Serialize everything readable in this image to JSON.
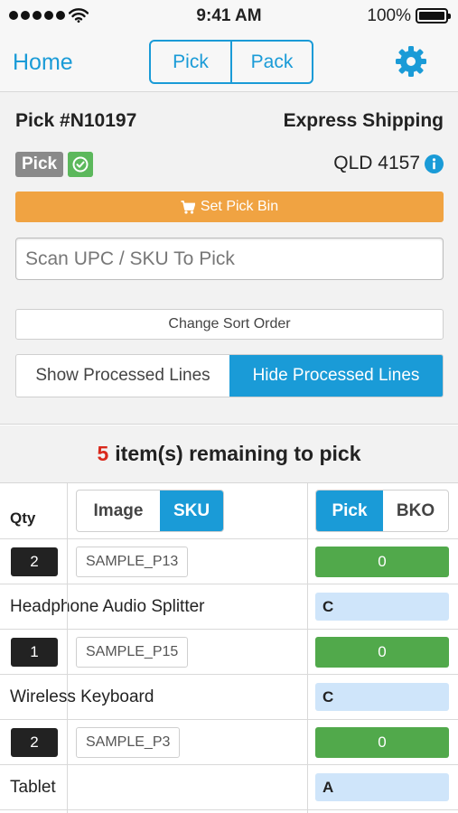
{
  "status_bar": {
    "time": "9:41 AM",
    "battery": "100%",
    "signal_icon": "signal-dots-icon",
    "wifi_icon": "wifi-icon",
    "battery_icon": "battery-icon"
  },
  "nav": {
    "home": "Home",
    "tabs": [
      "Pick",
      "Pack"
    ],
    "settings_icon": "gear-icon"
  },
  "order": {
    "title": "Pick #N10197",
    "shipping": "Express Shipping",
    "status": "Pick",
    "status_check_icon": "check-circle-icon",
    "postcode": "QLD 4157",
    "info_icon": "info-icon",
    "set_bin": "Set Pick Bin",
    "set_bin_icon": "cart-icon",
    "scan_placeholder": "Scan UPC / SKU To Pick",
    "sort_label": "Change Sort Order",
    "processed_toggle": {
      "show": "Show Processed Lines",
      "hide": "Hide Processed Lines",
      "active": "hide"
    }
  },
  "remaining": {
    "count": "5",
    "text": "item(s) remaining to pick"
  },
  "table": {
    "qty_header": "Qty",
    "view_toggle": {
      "image": "Image",
      "sku": "SKU",
      "active": "sku"
    },
    "mode_toggle": {
      "pick": "Pick",
      "bko": "BKO",
      "active": "pick"
    },
    "rows": [
      {
        "qty": "2",
        "sku": "SAMPLE_P13",
        "picked": "0",
        "name": "Headphone Audio Splitter",
        "bin": "C"
      },
      {
        "qty": "1",
        "sku": "SAMPLE_P15",
        "picked": "0",
        "name": "Wireless Keyboard",
        "bin": "C"
      },
      {
        "qty": "2",
        "sku": "SAMPLE_P3",
        "picked": "0",
        "name": "Tablet",
        "bin": "A"
      }
    ]
  },
  "colors": {
    "accent": "#1a9bd7",
    "warning": "#f0a342",
    "success": "#51a94b",
    "danger": "#d9291c",
    "bin_bg": "#cfe5fa"
  }
}
